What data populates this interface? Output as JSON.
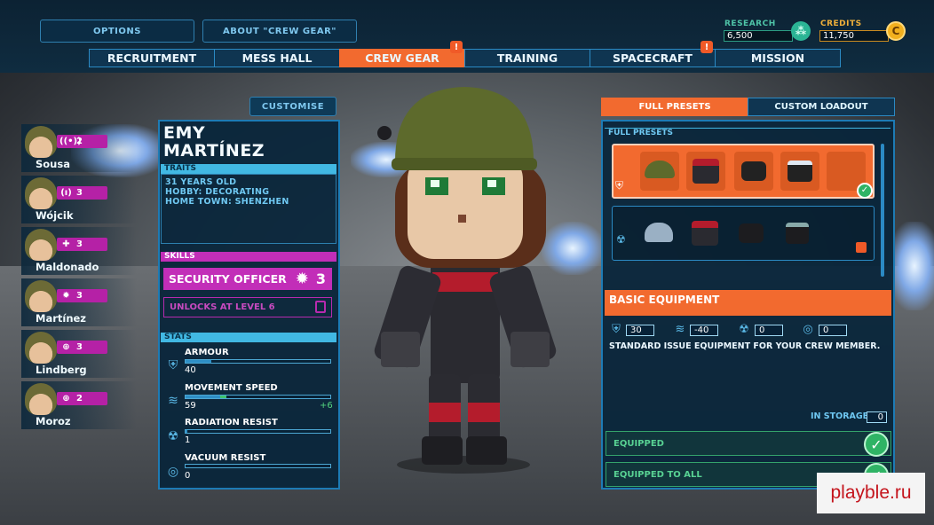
{
  "top_buttons": {
    "options": "OPTIONS",
    "about": "ABOUT \"CREW GEAR\""
  },
  "resources": {
    "research_label": "RESEARCH",
    "research_value": "6,500",
    "credits_label": "CREDITS",
    "credits_value": "11,750",
    "credits_icon_letter": "C"
  },
  "tabs": [
    {
      "label": "RECRUITMENT",
      "alert": false
    },
    {
      "label": "MESS HALL",
      "alert": false
    },
    {
      "label": "CREW GEAR",
      "alert": true,
      "active": true
    },
    {
      "label": "TRAINING",
      "alert": false
    },
    {
      "label": "SPACECRAFT",
      "alert": true
    },
    {
      "label": "MISSION",
      "alert": false
    }
  ],
  "alert_mark": "!",
  "crew": [
    {
      "name": "Sousa",
      "badge_icon": "radio-icon",
      "level": "2"
    },
    {
      "name": "Wójcik",
      "badge_icon": "signal-icon",
      "level": "3"
    },
    {
      "name": "Maldonado",
      "badge_icon": "medic-icon",
      "level": "3"
    },
    {
      "name": "Martínez",
      "badge_icon": "security-icon",
      "level": "3"
    },
    {
      "name": "Lindberg",
      "badge_icon": "target-icon",
      "level": "3"
    },
    {
      "name": "Moroz",
      "badge_icon": "target-icon",
      "level": "2"
    }
  ],
  "character": {
    "customise_label": "CUSTOMISE",
    "first_name": "EMY",
    "last_name": "MARTÍNEZ",
    "traits_header": "TRAITS",
    "traits": [
      "31 YEARS OLD",
      "HOBBY: DECORATING",
      "HOME TOWN: SHENZHEN"
    ],
    "skills_header": "SKILLS",
    "skill_name": "SECURITY OFFICER",
    "skill_level": "3",
    "unlock_text": "UNLOCKS AT LEVEL 6",
    "stats_header": "STATS",
    "stats": [
      {
        "name": "ARMOUR",
        "value": "40",
        "fraction": 0.18,
        "bonus": ""
      },
      {
        "name": "MOVEMENT SPEED",
        "value": "59",
        "fraction": 0.28,
        "bonus": "+6"
      },
      {
        "name": "RADIATION RESIST",
        "value": "1",
        "fraction": 0.01,
        "bonus": ""
      },
      {
        "name": "VACUUM RESIST",
        "value": "0",
        "fraction": 0.0,
        "bonus": ""
      }
    ]
  },
  "loadout": {
    "tab_full": "FULL PRESETS",
    "tab_custom": "CUSTOM LOADOUT",
    "section_header": "FULL PRESETS",
    "item_name": "BASIC EQUIPMENT",
    "modifiers": [
      "30",
      "-40",
      "0",
      "0"
    ],
    "description": "STANDARD ISSUE EQUIPMENT FOR YOUR CREW MEMBER.",
    "storage_label": "IN STORAGE",
    "storage_value": "0",
    "equipped_label": "EQUIPPED",
    "equipped_all_label": "EQUIPPED TO ALL"
  },
  "watermark": "playble.ru",
  "colors": {
    "accent": "#f26a2f",
    "panel_border": "#1d7bb5",
    "skill": "#c22eb8",
    "success": "#2fb365"
  }
}
